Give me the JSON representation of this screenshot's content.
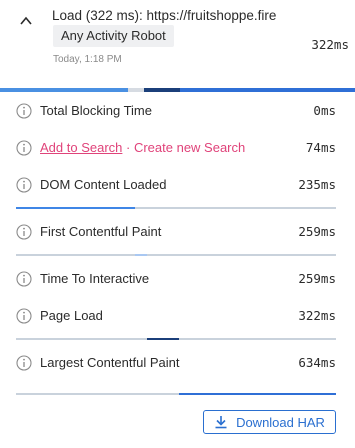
{
  "header": {
    "title": "Load (322 ms): https://fruitshoppe.fire",
    "tag": "Any Activity Robot",
    "timestamp": "Today, 1:18 PM",
    "value": "322ms"
  },
  "timeline": {
    "colors": {
      "light": "#4a90e2",
      "blue": "#2f6fd6",
      "dark": "#1b3f7a",
      "track": "#d6dbe2"
    }
  },
  "metrics": [
    {
      "label": "Total Blocking Time",
      "value": "0ms"
    },
    {
      "link_add": "Add to Search",
      "link_sep": " · ",
      "link_create": "Create new Search",
      "value": "74ms"
    },
    {
      "label": "DOM Content Loaded",
      "value": "235ms"
    },
    {
      "label": "First Contentful Paint",
      "value": "259ms"
    },
    {
      "label": "Time To Interactive",
      "value": "259ms"
    },
    {
      "label": "Page Load",
      "value": "322ms"
    },
    {
      "label": "Largest Contentful Paint",
      "value": "634ms"
    }
  ],
  "footer": {
    "download_label": "Download HAR"
  },
  "colors": {
    "accent": "#2a6fd0",
    "link": "#e0437a",
    "bar_light": "#3f86e6",
    "bar_dark": "#1b3f7a",
    "track": "#c9d2dc"
  },
  "icons": {
    "collapse": "chevron-up-icon",
    "info": "info-icon",
    "download": "download-icon"
  }
}
